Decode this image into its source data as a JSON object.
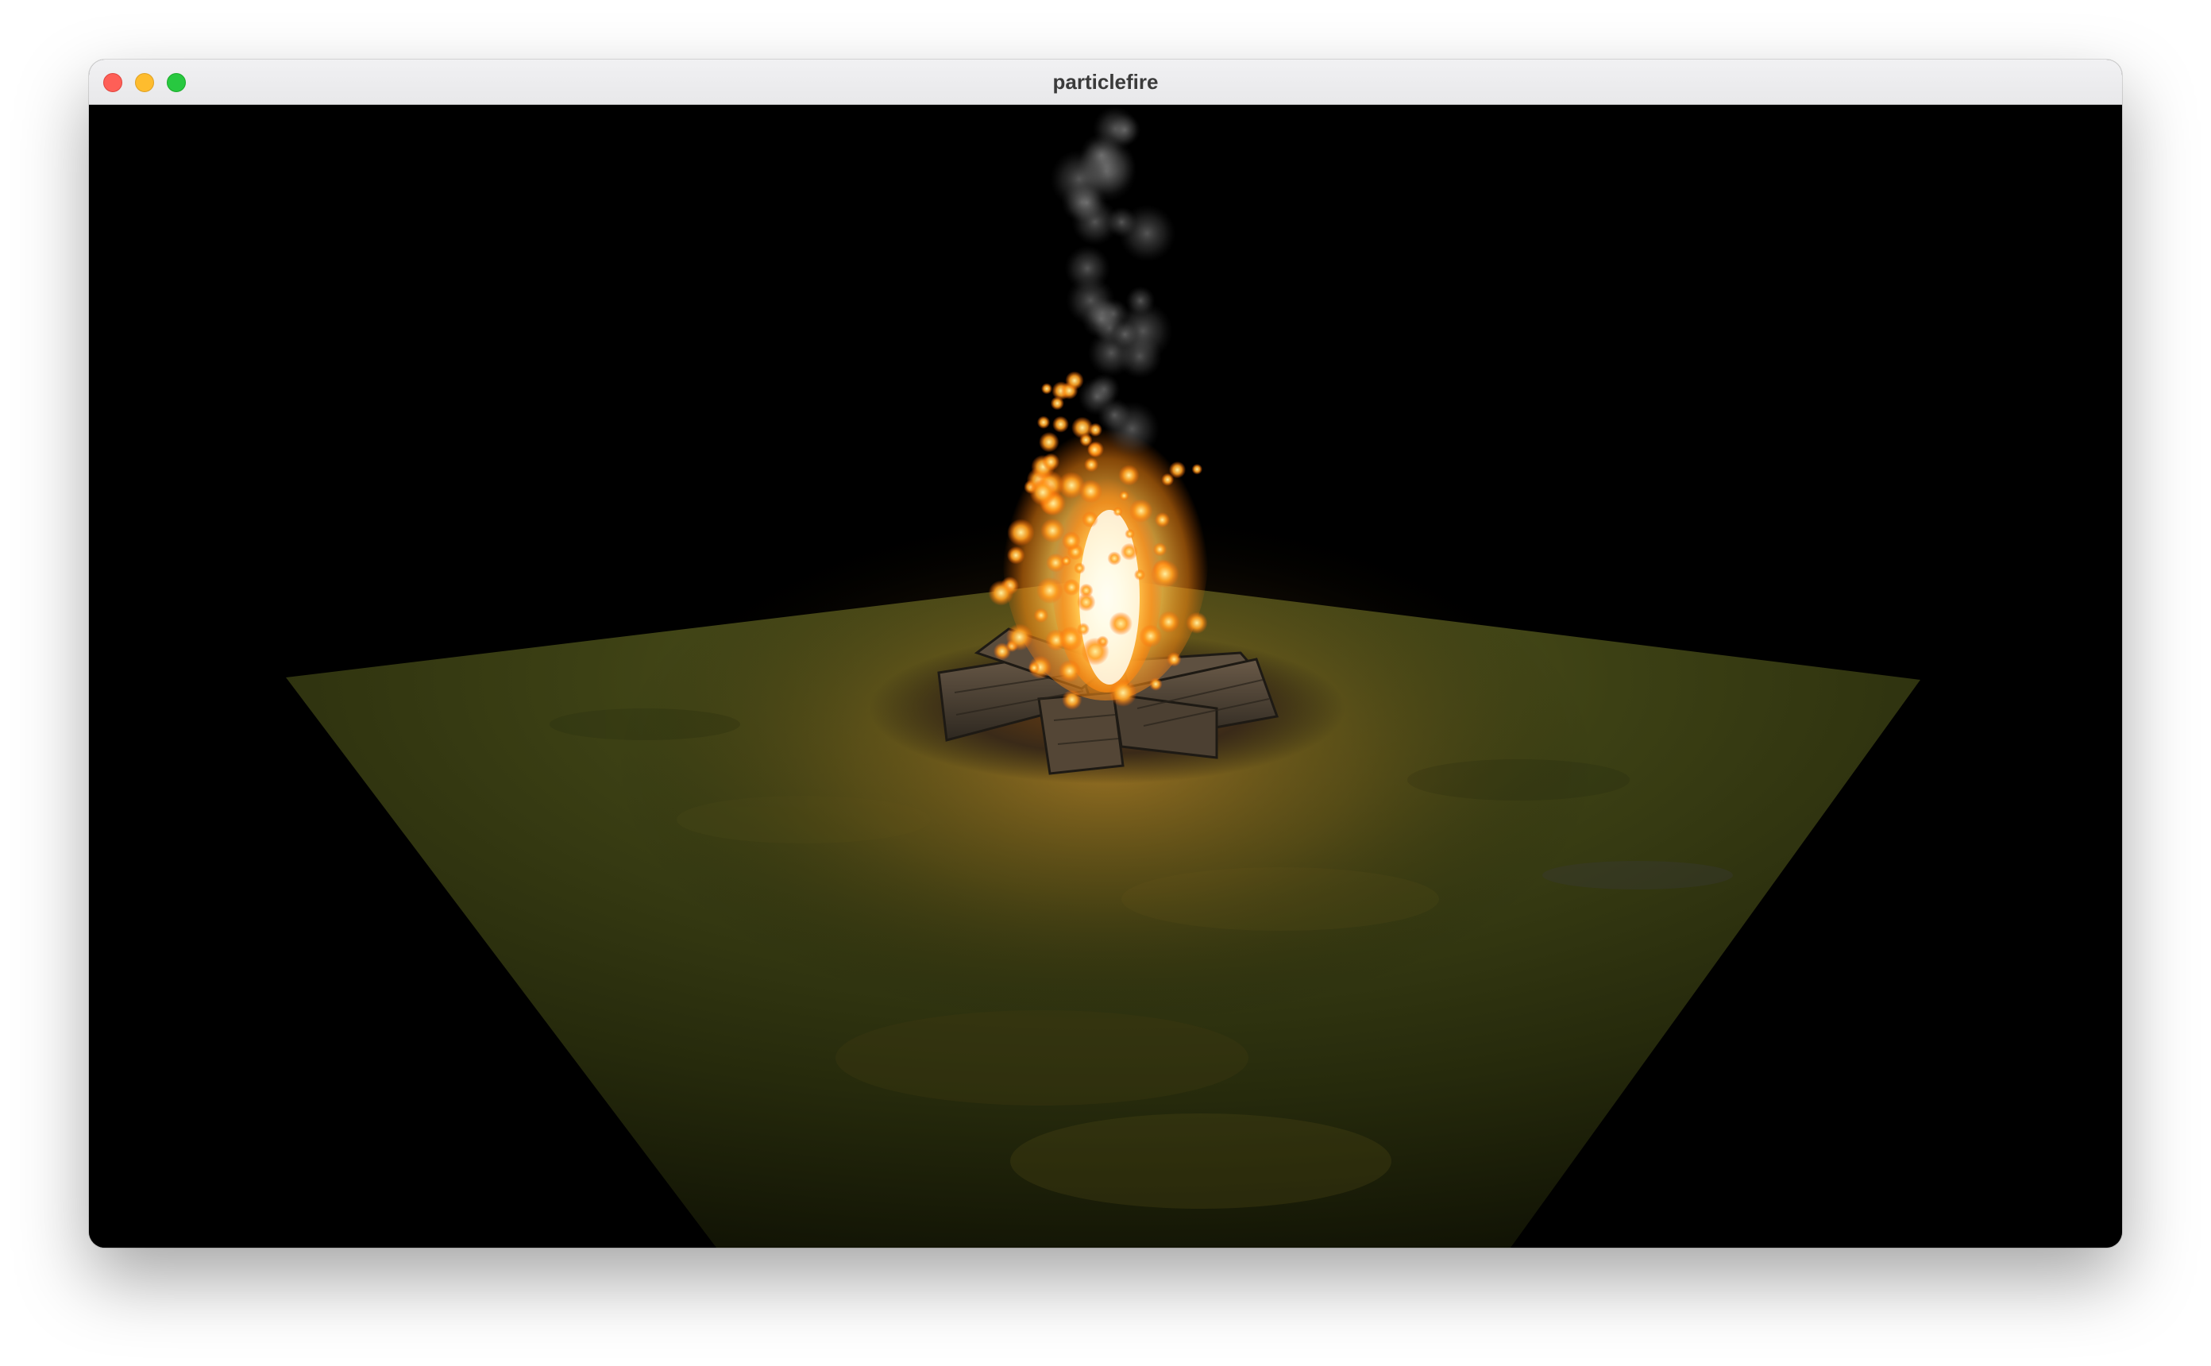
{
  "window": {
    "title": "particlefire"
  },
  "scene": {
    "background_color": "#000000",
    "ground_color": "#3a3f16",
    "fire_core_color": "#fff6c8",
    "fire_outer_color": "#ff9a1a",
    "smoke_color": "#8a8a8a",
    "log_color": "#4a4136"
  }
}
